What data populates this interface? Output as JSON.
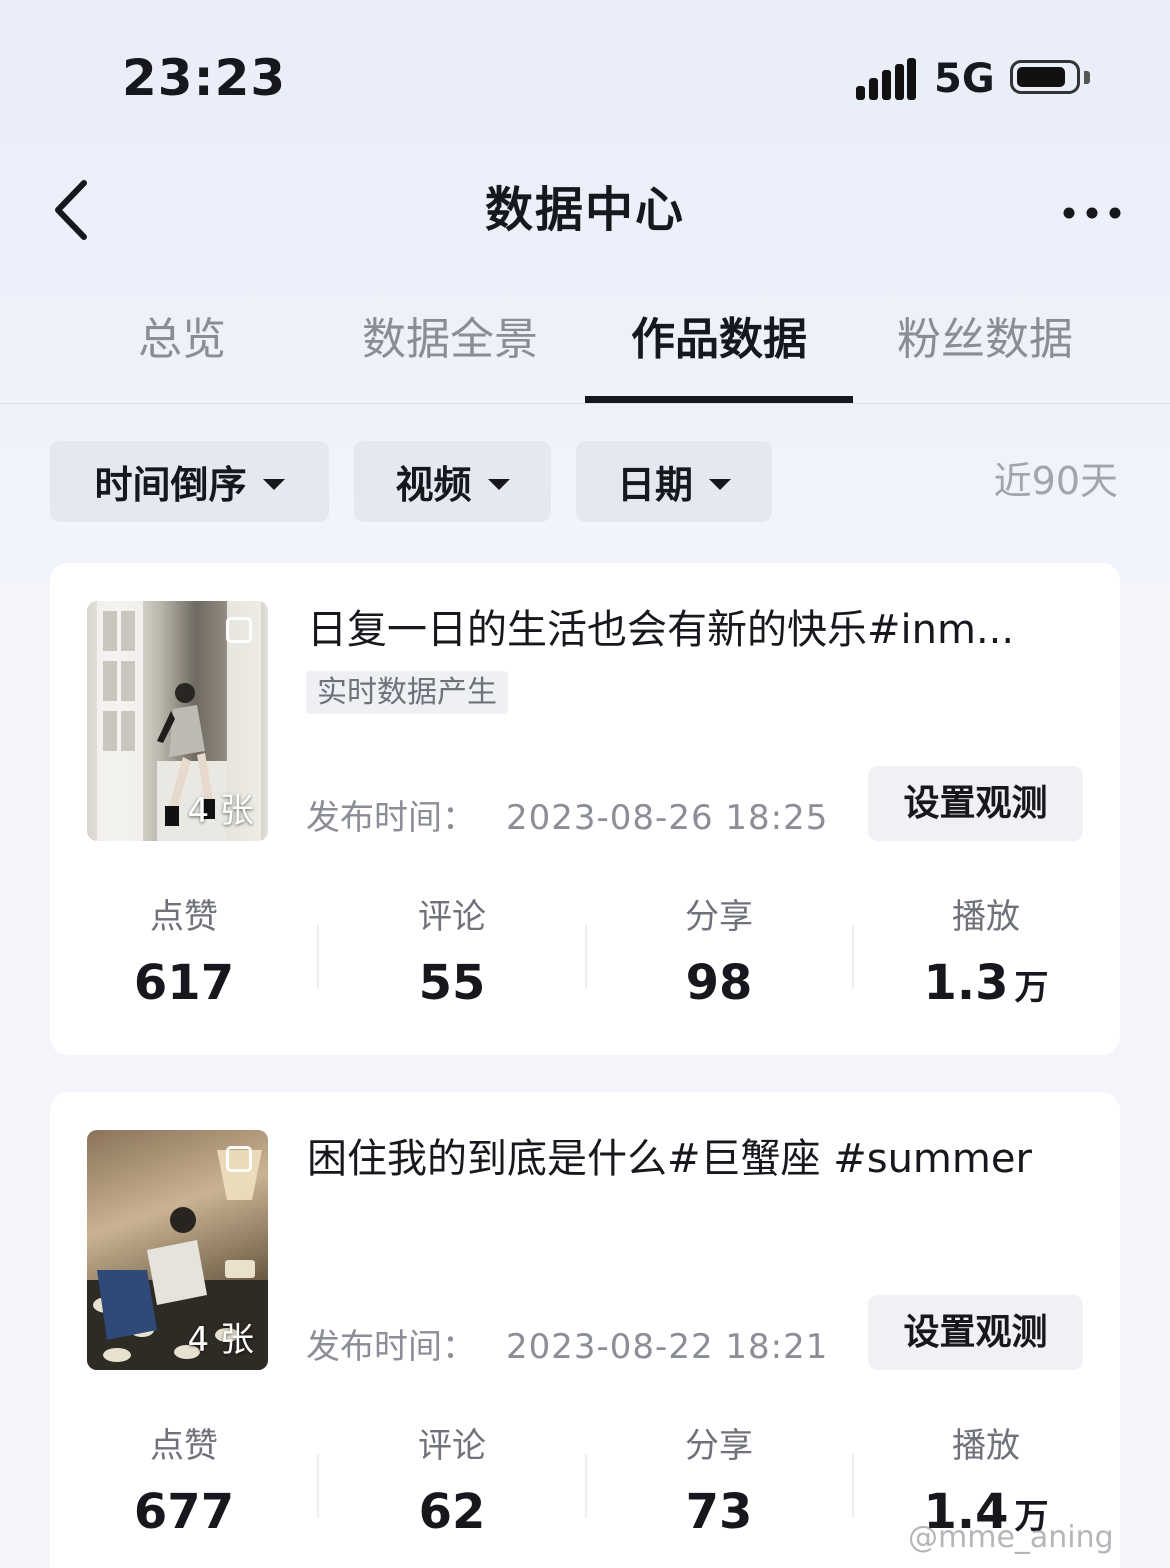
{
  "status_bar": {
    "time": "23:23",
    "network": "5G"
  },
  "nav": {
    "title": "数据中心"
  },
  "tabs": [
    {
      "label": "总览"
    },
    {
      "label": "数据全景"
    },
    {
      "label": "作品数据",
      "active": true
    },
    {
      "label": "粉丝数据"
    }
  ],
  "filters": {
    "sort": "时间倒序",
    "type": "视频",
    "date": "日期",
    "range": "近90天"
  },
  "posts": [
    {
      "title": "日复一日的生活也会有新的快乐#inm...",
      "tag": "实时数据产生",
      "image_count": "4 张",
      "publish_label": "发布时间：",
      "publish_time": "2023-08-26 18:25",
      "observe_label": "设置观测",
      "metrics": [
        {
          "label": "点赞",
          "value": "617"
        },
        {
          "label": "评论",
          "value": "55"
        },
        {
          "label": "分享",
          "value": "98"
        },
        {
          "label": "播放",
          "value": "1.3",
          "unit": "万"
        }
      ]
    },
    {
      "title": "困住我的到底是什么#巨蟹座 #summer",
      "image_count": "4 张",
      "publish_label": "发布时间：",
      "publish_time": "2023-08-22 18:21",
      "observe_label": "设置观测",
      "metrics": [
        {
          "label": "点赞",
          "value": "677"
        },
        {
          "label": "评论",
          "value": "62"
        },
        {
          "label": "分享",
          "value": "73"
        },
        {
          "label": "播放",
          "value": "1.4",
          "unit": "万"
        }
      ]
    }
  ],
  "watermark": "@mme_aning"
}
